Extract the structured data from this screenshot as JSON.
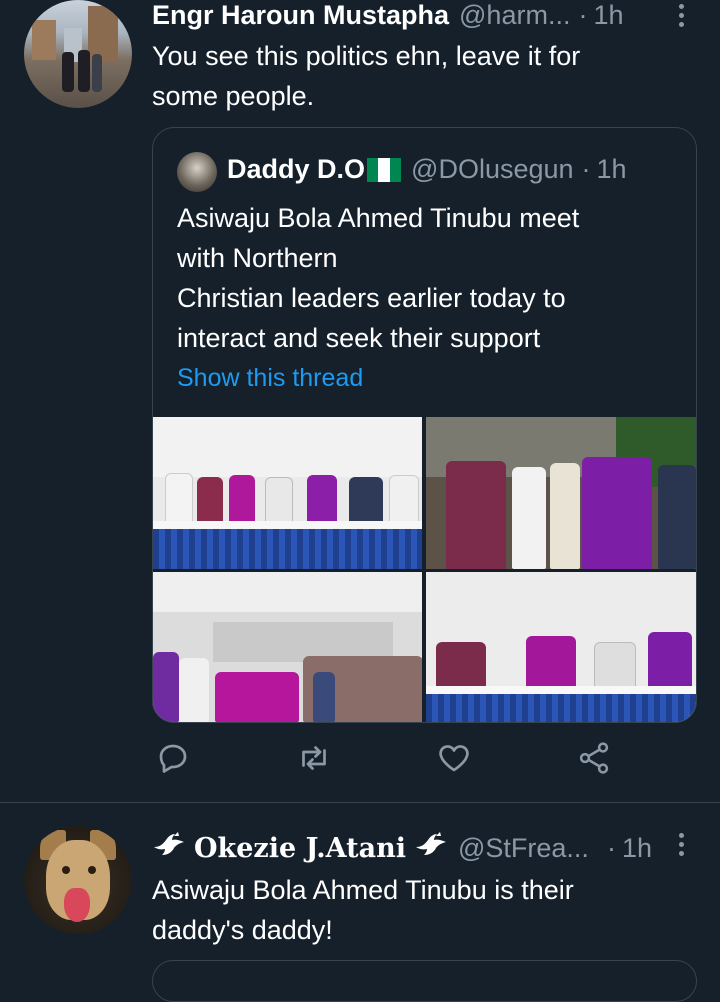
{
  "tweet1": {
    "name": "Engr Haroun Mustapha",
    "handle": "@harm...",
    "separator": "·",
    "time": "1h",
    "text_line1": "You see this politics ehn, leave it for",
    "text_line2": "some people.",
    "avatar_icon": "avatar-photo"
  },
  "quote": {
    "name": "Daddy D.O",
    "flag_icon": "nigeria-flag-icon",
    "flag_colors": [
      "#008751",
      "#ffffff",
      "#008751"
    ],
    "handle": "@DOlusegun",
    "separator": "·",
    "time": "1h",
    "text_line1": "Asiwaju Bola Ahmed Tinubu meet",
    "text_line2": "with Northern",
    "text_line3": "Christian leaders earlier today to",
    "text_line4": "interact and seek their support",
    "show_thread": "Show this thread"
  },
  "actions": {
    "reply_icon": "reply-icon",
    "retweet_icon": "retweet-icon",
    "like_icon": "heart-icon",
    "share_icon": "share-icon"
  },
  "tweet2": {
    "name": "Okezie J.Atani",
    "name_emoji_icon": "dove-icon",
    "handle": "@StFrea...",
    "separator": "·",
    "time": "1h",
    "text_line1": "Asiwaju Bola Ahmed Tinubu is their",
    "text_line2": "daddy's daddy!"
  },
  "colors": {
    "background": "#15202b",
    "secondary_text": "#8b98a5",
    "link": "#1d9bf0",
    "border": "#38444d"
  }
}
